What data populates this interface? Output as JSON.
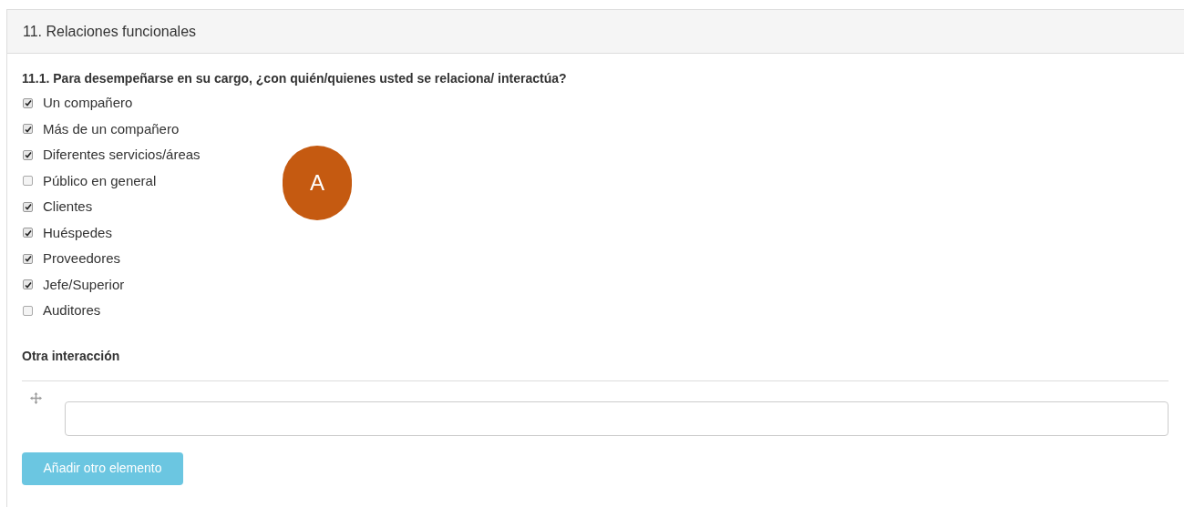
{
  "panel": {
    "title": "11. Relaciones funcionales"
  },
  "question": "11.1. Para desempeñarse en su cargo, ¿con quién/quienes usted se relaciona/ interactúa?",
  "options": [
    {
      "label": "Un compañero",
      "checked": true
    },
    {
      "label": "Más de un compañero",
      "checked": true
    },
    {
      "label": "Diferentes servicios/áreas",
      "checked": true
    },
    {
      "label": "Público en general",
      "checked": false
    },
    {
      "label": "Clientes",
      "checked": true
    },
    {
      "label": "Huéspedes",
      "checked": true
    },
    {
      "label": "Proveedores",
      "checked": true
    },
    {
      "label": "Jefe/Superior",
      "checked": true
    },
    {
      "label": "Auditores",
      "checked": false
    }
  ],
  "other": {
    "label": "Otra interacción",
    "add_button": "Añadir otro elemento"
  },
  "annotation": {
    "label": "A"
  }
}
